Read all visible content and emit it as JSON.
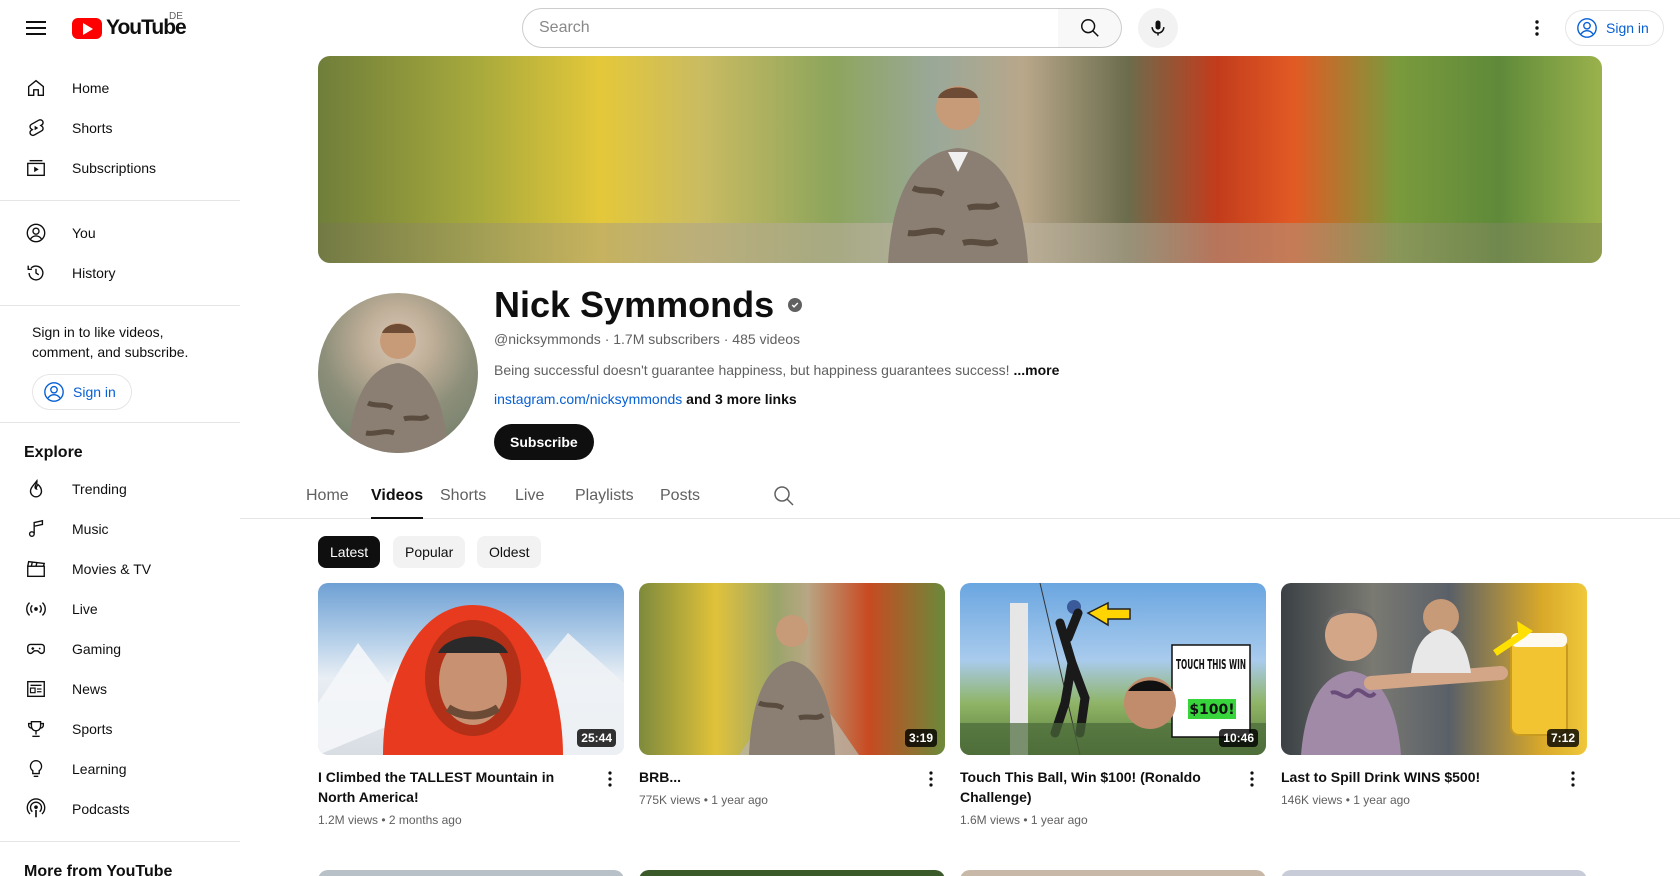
{
  "header": {
    "logo_text": "YouTube",
    "region": "DE",
    "search_placeholder": "Search",
    "sign_in": "Sign in"
  },
  "sidebar": {
    "primary": [
      {
        "label": "Home",
        "icon": "home-icon"
      },
      {
        "label": "Shorts",
        "icon": "shorts-icon"
      },
      {
        "label": "Subscriptions",
        "icon": "subscriptions-icon"
      }
    ],
    "secondary": [
      {
        "label": "You",
        "icon": "you-icon"
      },
      {
        "label": "History",
        "icon": "history-icon"
      }
    ],
    "signin_prompt": "Sign in to like videos, comment, and subscribe.",
    "signin_button": "Sign in",
    "explore_heading": "Explore",
    "explore": [
      {
        "label": "Trending",
        "icon": "trending-icon"
      },
      {
        "label": "Music",
        "icon": "music-icon"
      },
      {
        "label": "Movies & TV",
        "icon": "movies-icon"
      },
      {
        "label": "Live",
        "icon": "live-icon"
      },
      {
        "label": "Gaming",
        "icon": "gaming-icon"
      },
      {
        "label": "News",
        "icon": "news-icon"
      },
      {
        "label": "Sports",
        "icon": "sports-icon"
      },
      {
        "label": "Learning",
        "icon": "learning-icon"
      },
      {
        "label": "Podcasts",
        "icon": "podcasts-icon"
      }
    ],
    "more_heading": "More from YouTube"
  },
  "channel": {
    "name": "Nick Symmonds",
    "handle": "@nicksymmonds",
    "subscribers": "1.7M subscribers",
    "videos_count": "485 videos",
    "description": "Being successful doesn't guarantee happiness, but happiness guarantees success!",
    "more": "...more",
    "link": "instagram.com/nicksymmonds",
    "more_links": "and 3 more links",
    "subscribe": "Subscribe"
  },
  "tabs": [
    "Home",
    "Videos",
    "Shorts",
    "Live",
    "Playlists",
    "Posts"
  ],
  "active_tab": "Videos",
  "chips": [
    "Latest",
    "Popular",
    "Oldest"
  ],
  "active_chip": "Latest",
  "videos": [
    {
      "title": "I Climbed the TALLEST Mountain in North America!",
      "views": "1.2M views",
      "age": "2 months ago",
      "duration": "25:44"
    },
    {
      "title": "BRB...",
      "views": "775K views",
      "age": "1 year ago",
      "duration": "3:19"
    },
    {
      "title": "Touch This Ball, Win $100! (Ronaldo Challenge)",
      "views": "1.6M views",
      "age": "1 year ago",
      "duration": "10:46"
    },
    {
      "title": "Last to Spill Drink WINS $500!",
      "views": "146K views",
      "age": "1 year ago",
      "duration": "7:12"
    }
  ],
  "thumbnail_text": {
    "touch_win": "TOUCH THIS WIN",
    "prize": "$100!"
  },
  "colors": {
    "brand_red": "#ff0000",
    "link_blue": "#065fd4",
    "text_primary": "#0f0f0f",
    "text_secondary": "#606060"
  }
}
